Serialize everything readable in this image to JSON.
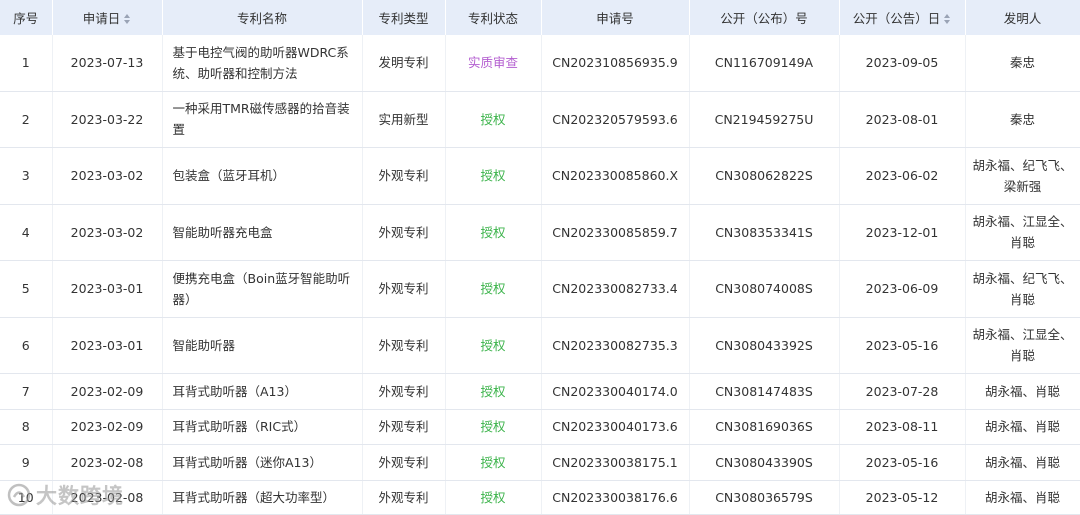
{
  "table": {
    "columns": [
      {
        "label": "序号",
        "sortable": false
      },
      {
        "label": "申请日",
        "sortable": true
      },
      {
        "label": "专利名称",
        "sortable": false
      },
      {
        "label": "专利类型",
        "sortable": false
      },
      {
        "label": "专利状态",
        "sortable": false
      },
      {
        "label": "申请号",
        "sortable": false
      },
      {
        "label": "公开（公布）号",
        "sortable": false
      },
      {
        "label": "公开（公告）日",
        "sortable": true
      },
      {
        "label": "发明人",
        "sortable": false
      }
    ],
    "rows": [
      {
        "seq": "1",
        "date": "2023-07-13",
        "name": "基于电控气阀的助听器WDRC系统、助听器和控制方法",
        "type": "发明专利",
        "status": "实质审查",
        "status_kind": "review",
        "app_no": "CN202310856935.9",
        "pub_no": "CN116709149A",
        "pub_date": "2023-09-05",
        "inventor": "秦忠"
      },
      {
        "seq": "2",
        "date": "2023-03-22",
        "name": "一种采用TMR磁传感器的拾音装置",
        "type": "实用新型",
        "status": "授权",
        "status_kind": "grant",
        "app_no": "CN202320579593.6",
        "pub_no": "CN219459275U",
        "pub_date": "2023-08-01",
        "inventor": "秦忠"
      },
      {
        "seq": "3",
        "date": "2023-03-02",
        "name": "包装盒（蓝牙耳机）",
        "type": "外观专利",
        "status": "授权",
        "status_kind": "grant",
        "app_no": "CN202330085860.X",
        "pub_no": "CN308062822S",
        "pub_date": "2023-06-02",
        "inventor": "胡永福、纪飞飞、梁新强"
      },
      {
        "seq": "4",
        "date": "2023-03-02",
        "name": "智能助听器充电盒",
        "type": "外观专利",
        "status": "授权",
        "status_kind": "grant",
        "app_no": "CN202330085859.7",
        "pub_no": "CN308353341S",
        "pub_date": "2023-12-01",
        "inventor": "胡永福、江显全、肖聪"
      },
      {
        "seq": "5",
        "date": "2023-03-01",
        "name": "便携充电盒（Boin蓝牙智能助听器）",
        "type": "外观专利",
        "status": "授权",
        "status_kind": "grant",
        "app_no": "CN202330082733.4",
        "pub_no": "CN308074008S",
        "pub_date": "2023-06-09",
        "inventor": "胡永福、纪飞飞、肖聪"
      },
      {
        "seq": "6",
        "date": "2023-03-01",
        "name": "智能助听器",
        "type": "外观专利",
        "status": "授权",
        "status_kind": "grant",
        "app_no": "CN202330082735.3",
        "pub_no": "CN308043392S",
        "pub_date": "2023-05-16",
        "inventor": "胡永福、江显全、肖聪"
      },
      {
        "seq": "7",
        "date": "2023-02-09",
        "name": "耳背式助听器（A13）",
        "type": "外观专利",
        "status": "授权",
        "status_kind": "grant",
        "app_no": "CN202330040174.0",
        "pub_no": "CN308147483S",
        "pub_date": "2023-07-28",
        "inventor": "胡永福、肖聪"
      },
      {
        "seq": "8",
        "date": "2023-02-09",
        "name": "耳背式助听器（RIC式）",
        "type": "外观专利",
        "status": "授权",
        "status_kind": "grant",
        "app_no": "CN202330040173.6",
        "pub_no": "CN308169036S",
        "pub_date": "2023-08-11",
        "inventor": "胡永福、肖聪"
      },
      {
        "seq": "9",
        "date": "2023-02-08",
        "name": "耳背式助听器（迷你A13）",
        "type": "外观专利",
        "status": "授权",
        "status_kind": "grant",
        "app_no": "CN202330038175.1",
        "pub_no": "CN308043390S",
        "pub_date": "2023-05-16",
        "inventor": "胡永福、肖聪"
      },
      {
        "seq": "10",
        "date": "2023-02-08",
        "name": "耳背式助听器（超大功率型）",
        "type": "外观专利",
        "status": "授权",
        "status_kind": "grant",
        "app_no": "CN202330038176.6",
        "pub_no": "CN308036579S",
        "pub_date": "2023-05-12",
        "inventor": "胡永福、肖聪"
      }
    ]
  },
  "watermark": {
    "text": "大数跨境"
  },
  "colors": {
    "header_bg": "#e6edf9",
    "status_review": "#b45fd0",
    "status_grant": "#3bb34a"
  }
}
